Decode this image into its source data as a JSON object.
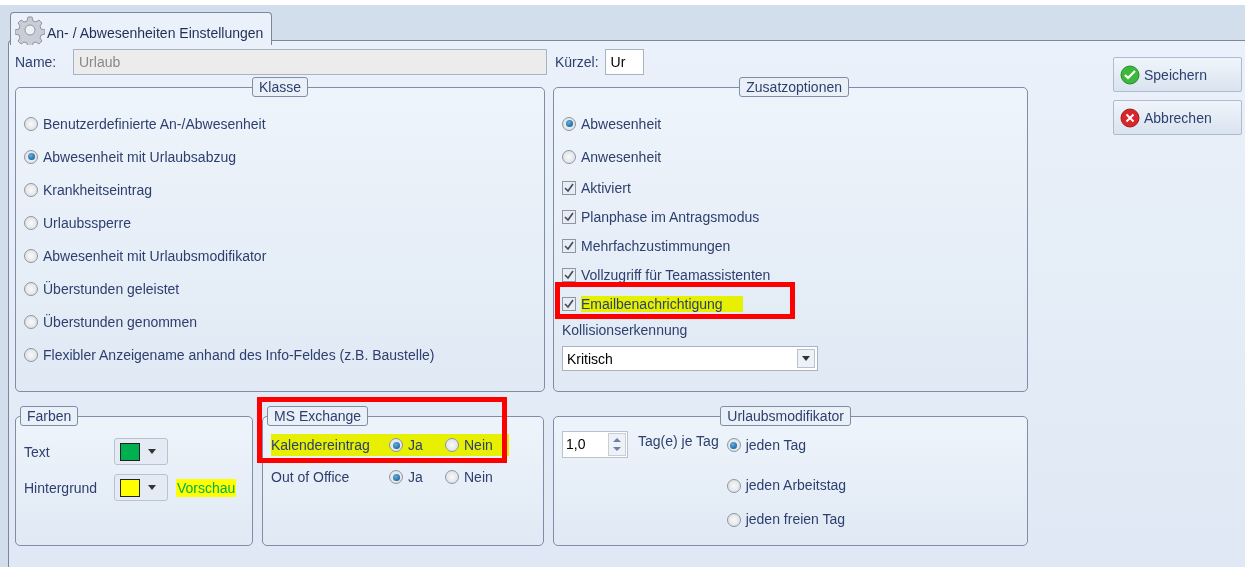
{
  "tab": {
    "title": "An- / Abwesenheiten Einstellungen",
    "selected": true
  },
  "name_field": {
    "label": "Name:",
    "value": "Urlaub",
    "disabled": true
  },
  "kuerzel_field": {
    "label": "Kürzel:",
    "value": "Ur"
  },
  "buttons": [
    {
      "label": "Speichern",
      "kind": "save"
    },
    {
      "label": "Abbrechen",
      "kind": "cancel"
    }
  ],
  "klasse": {
    "title": "Klasse",
    "options": [
      {
        "label": "Benutzerdefinierte An-/Abwesenheit",
        "selected": false
      },
      {
        "label": "Abwesenheit mit Urlaubsabzug",
        "selected": true
      },
      {
        "label": "Krankheitseintrag",
        "selected": false
      },
      {
        "label": "Urlaubssperre",
        "selected": false
      },
      {
        "label": "Abwesenheit mit Urlaubsmodifikator",
        "selected": false
      },
      {
        "label": "Überstunden geleistet",
        "selected": false
      },
      {
        "label": "Überstunden genommen",
        "selected": false
      },
      {
        "label": "Flexibler Anzeigename anhand des Info-Feldes (z.B. Baustelle)",
        "selected": false
      }
    ]
  },
  "zusatzoptionen": {
    "title": "Zusatzoptionen",
    "items": [
      {
        "kind": "radio",
        "label": "Abwesenheit",
        "selected": true,
        "highlighted": false
      },
      {
        "kind": "radio",
        "label": "Anwesenheit",
        "selected": false,
        "highlighted": false
      },
      {
        "kind": "checkbox",
        "label": "Aktiviert",
        "checked": true,
        "highlighted": false
      },
      {
        "kind": "checkbox",
        "label": "Planphase im Antragsmodus",
        "checked": true,
        "highlighted": false
      },
      {
        "kind": "checkbox",
        "label": "Mehrfachzustimmungen",
        "checked": true,
        "highlighted": false
      },
      {
        "kind": "checkbox",
        "label": "Vollzugriff für Teamassistenten",
        "checked": true,
        "highlighted": false
      },
      {
        "kind": "checkbox",
        "label": "Emailbenachrichtigung",
        "checked": true,
        "highlighted": true
      }
    ],
    "collision": {
      "label": "Kollisionserkennung",
      "value": "Kritisch"
    }
  },
  "farben": {
    "title": "Farben",
    "rows": [
      {
        "label": "Text",
        "color": "#00b050"
      },
      {
        "label": "Hintergrund",
        "color": "#ffff00"
      }
    ],
    "preview": "Vorschau"
  },
  "ms_exchange": {
    "title": "MS Exchange",
    "framed": true,
    "rows": [
      {
        "label": "Kalendereintrag",
        "highlighted": true,
        "options": [
          {
            "label": "Ja",
            "selected": true
          },
          {
            "label": "Nein",
            "selected": false
          }
        ]
      },
      {
        "label": "Out of Office",
        "highlighted": false,
        "options": [
          {
            "label": "Ja",
            "selected": true
          },
          {
            "label": "Nein",
            "selected": false
          }
        ]
      }
    ]
  },
  "urlaubsmodifikator": {
    "title": "Urlaubsmodifikator",
    "amount": "1,0",
    "unit": "Tag(e) je Tag",
    "options": [
      {
        "label": "jeden Tag",
        "selected": true
      },
      {
        "label": "jeden Arbeitstag",
        "selected": false
      },
      {
        "label": "jeden freien Tag",
        "selected": false
      }
    ]
  }
}
